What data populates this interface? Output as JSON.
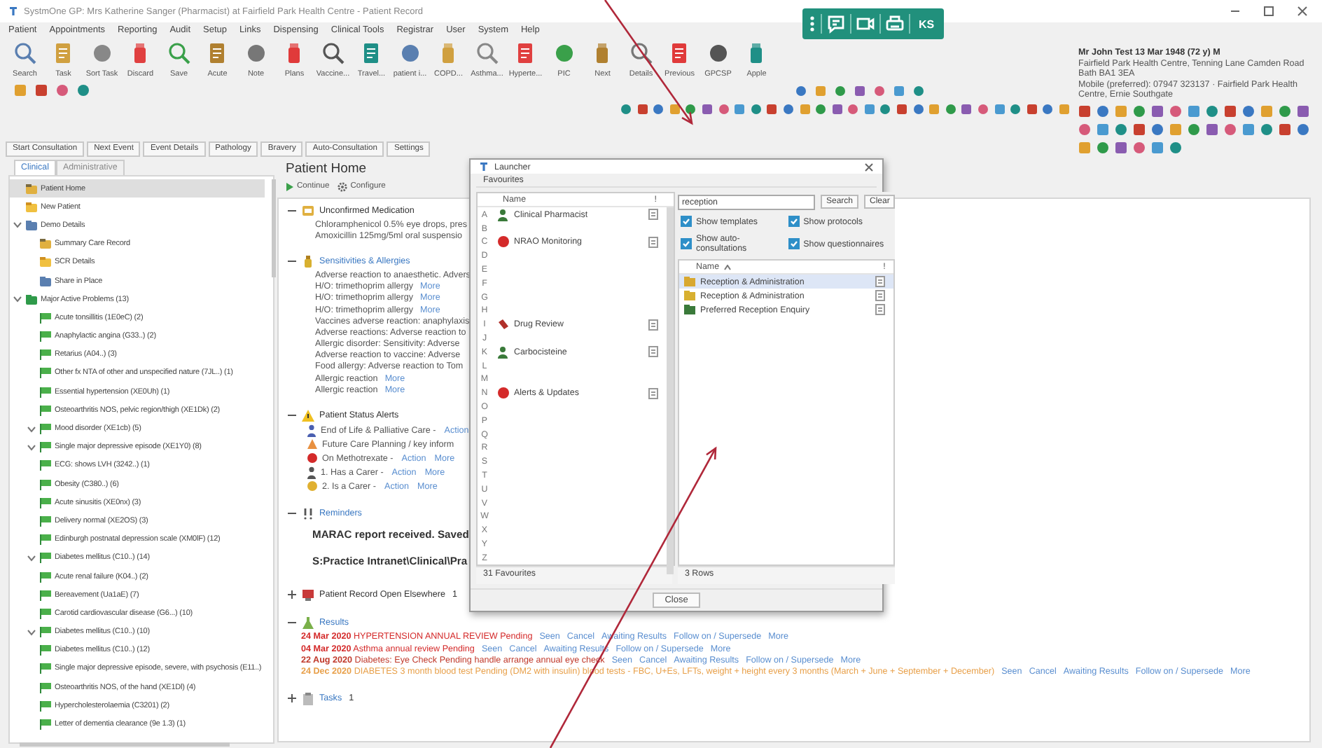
{
  "window": {
    "title": "SystmOne GP: Mrs Katherine Sanger (Pharmacist) at Fairfield Park Health Centre - Patient Record"
  },
  "floating_toolbar": {
    "initials": "KS"
  },
  "menu": [
    "Patient",
    "Appointments",
    "Reporting",
    "Audit",
    "Setup",
    "Links",
    "Dispensing",
    "Clinical Tools",
    "Registrar",
    "User",
    "System",
    "Help"
  ],
  "toolbar": [
    "Search",
    "Task",
    "Sort Task",
    "Discard",
    "Save",
    "Acute",
    "Note",
    "Plans",
    "Vaccine...",
    "Travel...",
    "patient i...",
    "COPD...",
    "Asthma...",
    "Hyperte...",
    "PIC",
    "Next",
    "Details",
    "Previous",
    "GPCSP",
    "Apple"
  ],
  "patient": {
    "name": "Mr John Test 13 Mar 1948 (72 y) M",
    "address": "Fairfield Park Health Centre, Tenning Lane Camden Road Bath BA1 3EA",
    "contact": "Mobile (preferred): 07947 323137 · Fairfield Park Health Centre, Ernie Southgate"
  },
  "record_tabs": [
    "Start Consultation",
    "Next Event",
    "Event Details",
    "Pathology",
    "Bravery",
    "Auto-Consultation",
    "Settings"
  ],
  "sidebar": {
    "tabs": [
      {
        "label": "Clinical",
        "selected": true
      },
      {
        "label": "Administrative",
        "selected": false
      }
    ],
    "items": [
      {
        "label": "Patient Home",
        "selected": true
      },
      {
        "label": "New Patient",
        "selected": false
      },
      {
        "label": "Demo Details",
        "selected": false,
        "expanded": true,
        "children": [
          {
            "label": "Summary Care Record",
            "selected": false
          },
          {
            "label": "SCR Details",
            "selected": false
          },
          {
            "label": "Share in Place",
            "selected": false
          }
        ]
      },
      {
        "label": "Major Active Problems (13)",
        "selected": false,
        "expanded": true,
        "children": [
          {
            "label": "Acute tonsillitis (1E0eC) (2)",
            "selected": false
          },
          {
            "label": "Anaphylactic angina (G33..) (2)",
            "selected": false
          },
          {
            "label": "Retarius (A04..) (3)",
            "selected": false
          },
          {
            "label": "Other fx NTA of other and unspecified nature (7JL..) (1)",
            "selected": false
          },
          {
            "label": "Essential hypertension (XE0Uh) (1)",
            "selected": false
          },
          {
            "label": "Osteoarthritis NOS, pelvic region/thigh (XE1Dk) (2)",
            "selected": false
          },
          {
            "label": "Mood disorder (XE1cb) (5)",
            "selected": false,
            "expanded": true
          },
          {
            "label": "Single major depressive episode (XE1Y0) (8)",
            "selected": false,
            "expanded": true
          },
          {
            "label": "ECG: shows LVH (3242..) (1)",
            "selected": false
          },
          {
            "label": "Obesity (C380..) (6)",
            "selected": false
          },
          {
            "label": "Acute sinusitis (XE0nx) (3)",
            "selected": false
          },
          {
            "label": "Delivery normal (XE2OS) (3)",
            "selected": false
          },
          {
            "label": "Edinburgh postnatal depression scale (XM0lF) (12)",
            "selected": false
          },
          {
            "label": "Diabetes mellitus (C10..) (14)",
            "selected": false,
            "expanded": true
          },
          {
            "label": "Acute renal failure (K04..) (2)",
            "selected": false
          },
          {
            "label": "Bereavement (Ua1aE) (7)",
            "selected": false
          },
          {
            "label": "Carotid cardiovascular disease (G6...) (10)",
            "selected": false
          },
          {
            "label": "Diabetes mellitus (C10..) (10)",
            "selected": false,
            "expanded": true
          },
          {
            "label": "Diabetes mellitus (C10..) (12)",
            "selected": false
          },
          {
            "label": "Single major depressive episode, severe, with psychosis (E11..)",
            "selected": false
          },
          {
            "label": "Osteoarthritis NOS, of the hand (XE1Dl) (4)",
            "selected": false
          },
          {
            "label": "Hypercholesterolaemia (C3201) (2)",
            "selected": false
          },
          {
            "label": "Letter of dementia clearance (9e 1.3) (1)",
            "selected": false
          }
        ]
      }
    ]
  },
  "patient_home": {
    "title": "Patient Home",
    "actions": [
      "Continue",
      "Configure"
    ],
    "sections": [
      {
        "kind": "lines",
        "title": "Unconfirmed Medication",
        "link": false,
        "expanded": true,
        "lines": [
          {
            "text": "Chloramphenicol 0.5% eye drops, pres"
          },
          {
            "text": "Amoxicillin 125mg/5ml oral suspensio"
          }
        ]
      },
      {
        "kind": "lines",
        "title": "Sensitivities & Allergies",
        "link": true,
        "expanded": true,
        "lines": [
          {
            "text": "Adverse reaction to anaesthetic. Advers"
          },
          {
            "text": "H/O: trimethoprim allergy",
            "links": [
              "More"
            ]
          },
          {
            "text": "H/O: trimethoprim allergy",
            "links": [
              "More"
            ]
          },
          {
            "text": "H/O: trimethoprim allergy",
            "links": [
              "More"
            ]
          },
          {
            "text": "Vaccines adverse reaction: anaphylaxis"
          },
          {
            "text": "Adverse reactions: Adverse reaction to"
          },
          {
            "text": "Allergic disorder: Sensitivity: Adverse"
          },
          {
            "text": "Adverse reaction to vaccine: Adverse"
          },
          {
            "text": "Food allergy: Adverse reaction to Tom"
          },
          {
            "text": "Allergic reaction",
            "links": [
              "More"
            ]
          },
          {
            "text": "Allergic reaction",
            "links": [
              "More"
            ]
          }
        ]
      },
      {
        "kind": "alerts",
        "title": "Patient Status Alerts",
        "link": false,
        "expanded": true,
        "lines": [
          {
            "text": "End of Life & Palliative Care -",
            "links": [
              "Action"
            ]
          },
          {
            "text": "Future Care Planning / key inform"
          },
          {
            "text": "On Methotrexate -",
            "links": [
              "Action",
              "More"
            ]
          },
          {
            "text": "1. Has a Carer -",
            "links": [
              "Action",
              "More"
            ]
          },
          {
            "text": "2. Is a Carer -",
            "links": [
              "Action",
              "More"
            ]
          }
        ]
      },
      {
        "kind": "reminders",
        "title": "Reminders",
        "link": true,
        "expanded": true,
        "lines": [
          {
            "text": "MARAC report received.  Saved"
          },
          {
            "text": "S:Practice Intranet\\Clinical\\Pra"
          }
        ]
      },
      {
        "kind": "count",
        "title": "Patient Record Open Elsewhere",
        "link": false,
        "expanded": false,
        "count": "1"
      },
      {
        "kind": "results",
        "title": "Results",
        "link": true,
        "expanded": true,
        "lines": [
          {
            "date": "24 Mar 2020",
            "text": "HYPERTENSION ANNUAL REVIEW Pending",
            "color": "#d42a2a",
            "links": [
              "Seen",
              "Cancel",
              "Awaiting Results",
              "Follow on / Supersede",
              "More"
            ]
          },
          {
            "date": "04 Mar 2020",
            "text": "Asthma annual review Pending",
            "color": "#d42a2a",
            "links": [
              "Seen",
              "Cancel",
              "Awaiting Results",
              "Follow on / Supersede",
              "More"
            ]
          },
          {
            "date": "22 Aug 2020",
            "text": "Diabetes: Eye Check Pending handle arrange annual eye check",
            "color": "#c0392b",
            "links": [
              "Seen",
              "Cancel",
              "Awaiting Results",
              "Follow on / Supersede",
              "More"
            ]
          },
          {
            "date": "24 Dec 2020",
            "text": "DIABETES 3 month blood test Pending (DM2 with insulin) blood tests - FBC, U+Es, LFTs, weight + height every 3 months (March + June + September + December)",
            "color": "#e8a04a",
            "links": [
              "Seen",
              "Cancel",
              "Awaiting Results",
              "Follow on / Supersede",
              "More"
            ]
          }
        ]
      },
      {
        "kind": "count",
        "title": "Tasks",
        "link": true,
        "expanded": false,
        "count": "1"
      }
    ]
  },
  "launcher": {
    "title": "Launcher",
    "favourites_label": "Favourites",
    "favourites": {
      "columns": [
        "Name",
        "!"
      ],
      "letters": [
        {
          "letter": "A",
          "item": "Clinical Pharmacist"
        },
        {
          "letter": "B"
        },
        {
          "letter": "C",
          "item": "NRAO Monitoring"
        },
        {
          "letter": "D"
        },
        {
          "letter": "E"
        },
        {
          "letter": "F"
        },
        {
          "letter": "G"
        },
        {
          "letter": "H"
        },
        {
          "letter": "I",
          "item": "Drug Review"
        },
        {
          "letter": "J"
        },
        {
          "letter": "K",
          "item": "Carbocisteine"
        },
        {
          "letter": "L"
        },
        {
          "letter": "M"
        },
        {
          "letter": "N",
          "item": "Alerts & Updates"
        },
        {
          "letter": "O"
        },
        {
          "letter": "P"
        },
        {
          "letter": "Q"
        },
        {
          "letter": "R"
        },
        {
          "letter": "S"
        },
        {
          "letter": "T"
        },
        {
          "letter": "U"
        },
        {
          "letter": "V"
        },
        {
          "letter": "W"
        },
        {
          "letter": "X"
        },
        {
          "letter": "Y"
        },
        {
          "letter": "Z"
        }
      ],
      "footer": "31 Favourites"
    },
    "search": {
      "value": "reception",
      "buttons": [
        "Search",
        "Clear"
      ]
    },
    "options": [
      {
        "label": "Show templates",
        "checked": true
      },
      {
        "label": "Show protocols",
        "checked": true
      },
      {
        "label": "Show auto-consultations",
        "checked": true
      },
      {
        "label": "Show questionnaires",
        "checked": true
      }
    ],
    "results": {
      "columns": [
        "Name",
        "!"
      ],
      "rows": [
        {
          "name": "Reception & Administration",
          "selected": true
        },
        {
          "name": "Reception & Administration",
          "selected": false
        },
        {
          "name": "Preferred Reception Enquiry",
          "selected": false
        }
      ],
      "footer": "3 Rows"
    },
    "close_button": "Close"
  },
  "annotation_arrows": [
    {
      "kind": "arrow"
    },
    {
      "kind": "arrow"
    }
  ]
}
